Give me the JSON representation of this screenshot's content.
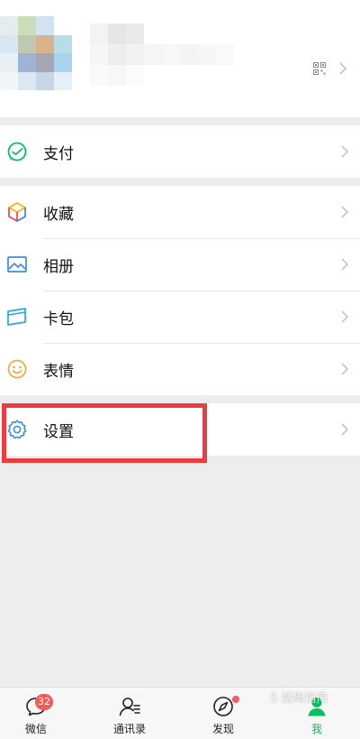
{
  "menu": {
    "payment": "支付",
    "favorites": "收藏",
    "album": "相册",
    "cards": "卡包",
    "stickers": "表情",
    "settings": "设置"
  },
  "tabs": {
    "chats": "微信",
    "chats_badge": "32",
    "contacts": "通讯录",
    "discover": "发现",
    "me": "我"
  },
  "colors": {
    "accent": "#07c160",
    "highlight_border": "#ee3b40",
    "badge": "#f65b5b"
  },
  "watermark": "S 搜狗指南"
}
